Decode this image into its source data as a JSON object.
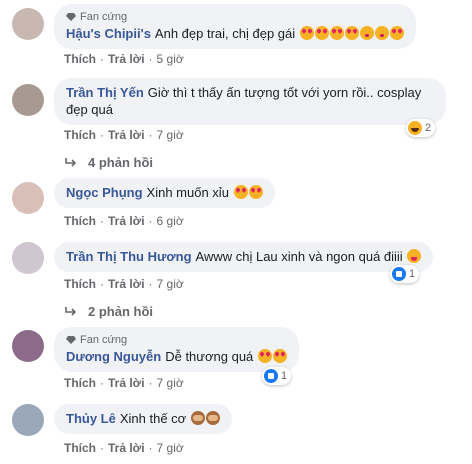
{
  "comments": [
    {
      "fan_badge": "Fan cứng",
      "author": "Hậu's Chipii's",
      "text": "Anh đẹp trai, chị đẹp gái",
      "emojis": [
        "heart-eyes",
        "heart-eyes",
        "heart-eyes",
        "heart-eyes",
        "kiss",
        "kiss",
        "heart-eyes"
      ],
      "like": "Thích",
      "reply": "Trả lời",
      "time": "5 giờ",
      "avatar_color": "#c9b7b2"
    },
    {
      "author": "Trần Thị Yến",
      "text_line1": "Giờ thì t thấy ấn tượng tốt với yorn rồi.. cosplay",
      "text_line2": "đẹp quá",
      "like": "Thích",
      "reply": "Trả lời",
      "time": "7 giờ",
      "reaction_count": "2",
      "replies": "4 phản hồi",
      "avatar_color": "#a89a93"
    },
    {
      "author": "Ngọc Phụng",
      "text": "Xinh muốn xỉu",
      "emojis": [
        "heart-eyes",
        "heart-eyes"
      ],
      "like": "Thích",
      "reply": "Trả lời",
      "time": "6 giờ",
      "avatar_color": "#d8c0b8"
    },
    {
      "author": "Trần Thị Thu Hương",
      "text": "Awww chị Lau xinh và ngon quá điiii",
      "emojis": [
        "tongue"
      ],
      "like": "Thích",
      "reply": "Trả lời",
      "time": "7 giờ",
      "reaction_count": "1",
      "replies": "2 phản hồi",
      "avatar_color": "#cfc6cf"
    },
    {
      "fan_badge": "Fan cứng",
      "author": "Dương Nguyễn",
      "text": "Dễ thương quá",
      "emojis": [
        "heart-eyes",
        "heart-eyes"
      ],
      "like": "Thích",
      "reply": "Trả lời",
      "time": "7 giờ",
      "reaction_count": "1",
      "avatar_color": "#8c6b8a"
    },
    {
      "author": "Thủy Lê",
      "text": "Xinh thế cơ",
      "emojis": [
        "monkey",
        "monkey"
      ],
      "like": "Thích",
      "reply": "Trả lời",
      "time": "7 giờ",
      "avatar_color": "#9aa7b8"
    }
  ],
  "icons": {
    "fan_badge": "diamond-icon",
    "reply_arrow": "reply-arrow-icon",
    "haha": "haha-reaction-icon",
    "like": "like-reaction-icon"
  }
}
